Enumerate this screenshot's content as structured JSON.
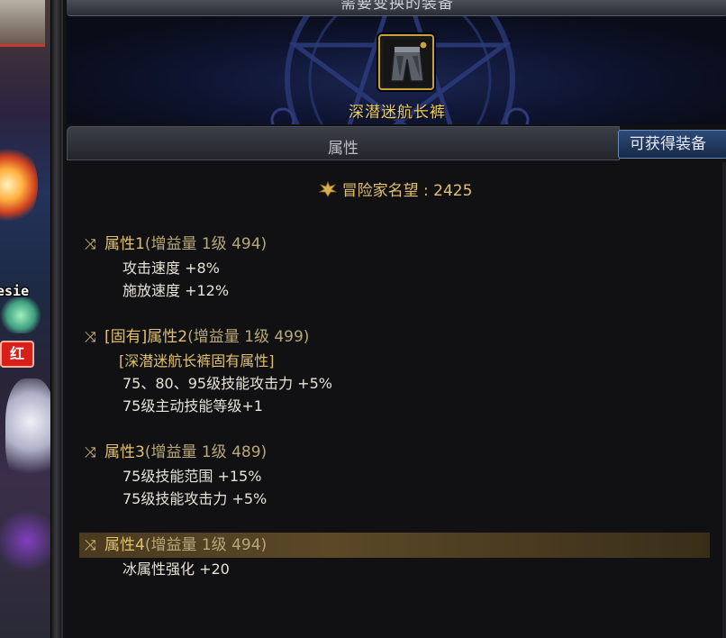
{
  "header": {
    "title": "需要变换的装备"
  },
  "equipment": {
    "name": "深潜迷航长裤",
    "icon": "pants-icon"
  },
  "attributes_header": {
    "title": "属性",
    "obtain_button": "可获得装备"
  },
  "renown": {
    "label": "冒险家名望 : 2425"
  },
  "attributes": [
    {
      "title": "属性1",
      "sub": "(增益量 1级 494)",
      "lines": [
        "攻击速度 +8%",
        "施放速度 +12%"
      ]
    },
    {
      "title": "[固有]属性2",
      "sub": "(增益量 1级 499)",
      "fixed_line": "[深潜迷航长裤固有属性]",
      "lines": [
        "75、80、95级技能攻击力 +5%",
        "75级主动技能等级+1"
      ]
    },
    {
      "title": "属性3",
      "sub": "(增益量 1级 489)",
      "lines": [
        "75级技能范围 +15%",
        "75级技能攻击力 +5%"
      ]
    },
    {
      "title": "属性4",
      "sub": "(增益量 1级 494)",
      "lines": [
        "冰属性强化 +20"
      ]
    }
  ],
  "scene": {
    "name_tag": "esie",
    "badge": "红"
  },
  "colors": {
    "gold": "#e0c070",
    "equip_name": "#f0d060",
    "button_blue": "#2c4a78"
  }
}
